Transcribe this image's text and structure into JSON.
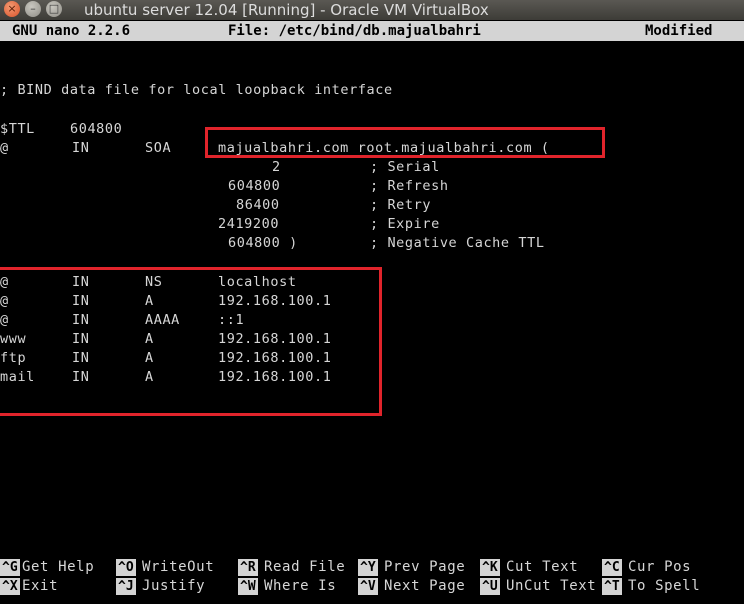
{
  "window": {
    "title": "ubuntu server 12.04  [Running] - Oracle VM VirtualBox",
    "buttons": {
      "close": "×",
      "minimize": "–",
      "maximize": "□"
    }
  },
  "nano": {
    "version": "GNU nano 2.2.6",
    "file": "File: /etc/bind/db.majualbahri",
    "status": "Modified"
  },
  "editor": {
    "comment": "; BIND data file for local loopback interface",
    "lines": [
      {
        "c1": "$TTL",
        "c2": "604800"
      },
      {
        "c1": "@",
        "c2": "IN",
        "c3": "SOA",
        "c4": "majualbahri.com root.majualbahri.com ("
      },
      {
        "c4": "2",
        "c5": "; Serial"
      },
      {
        "c4": "604800",
        "c5": "; Refresh"
      },
      {
        "c4": "86400",
        "c5": "; Retry"
      },
      {
        "c4": "2419200",
        "c5": "; Expire"
      },
      {
        "c4": "604800 )",
        "c5": "; Negative Cache TTL"
      },
      {
        "c1": "@",
        "c2": "IN",
        "c3": "NS",
        "c4": "localhost"
      },
      {
        "c1": "@",
        "c2": "IN",
        "c3": "A",
        "c4": "192.168.100.1"
      },
      {
        "c1": "@",
        "c2": "IN",
        "c3": "AAAA",
        "c4": "::1"
      },
      {
        "c1": "www",
        "c2": "IN",
        "c3": "A",
        "c4": "192.168.100.1"
      },
      {
        "c1": "ftp",
        "c2": "IN",
        "c3": "A",
        "c4": "192.168.100.1"
      },
      {
        "c1": "mail",
        "c2": "IN",
        "c3": "A",
        "c4": "192.168.100.1"
      }
    ]
  },
  "shortcuts": [
    {
      "key": "^G",
      "label": "Get Help"
    },
    {
      "key": "^X",
      "label": "Exit"
    },
    {
      "key": "^O",
      "label": "WriteOut"
    },
    {
      "key": "^J",
      "label": "Justify"
    },
    {
      "key": "^R",
      "label": "Read File"
    },
    {
      "key": "^W",
      "label": "Where Is"
    },
    {
      "key": "^Y",
      "label": "Prev Page"
    },
    {
      "key": "^V",
      "label": "Next Page"
    },
    {
      "key": "^K",
      "label": "Cut Text"
    },
    {
      "key": "^U",
      "label": "UnCut Text"
    },
    {
      "key": "^C",
      "label": "Cur Pos"
    },
    {
      "key": "^T",
      "label": "To Spell"
    }
  ],
  "colors": {
    "terminal_bg": "#000000",
    "terminal_fg": "#d6d6d6",
    "header_bg": "#d4d4d4",
    "highlight_border": "#e0242b"
  }
}
